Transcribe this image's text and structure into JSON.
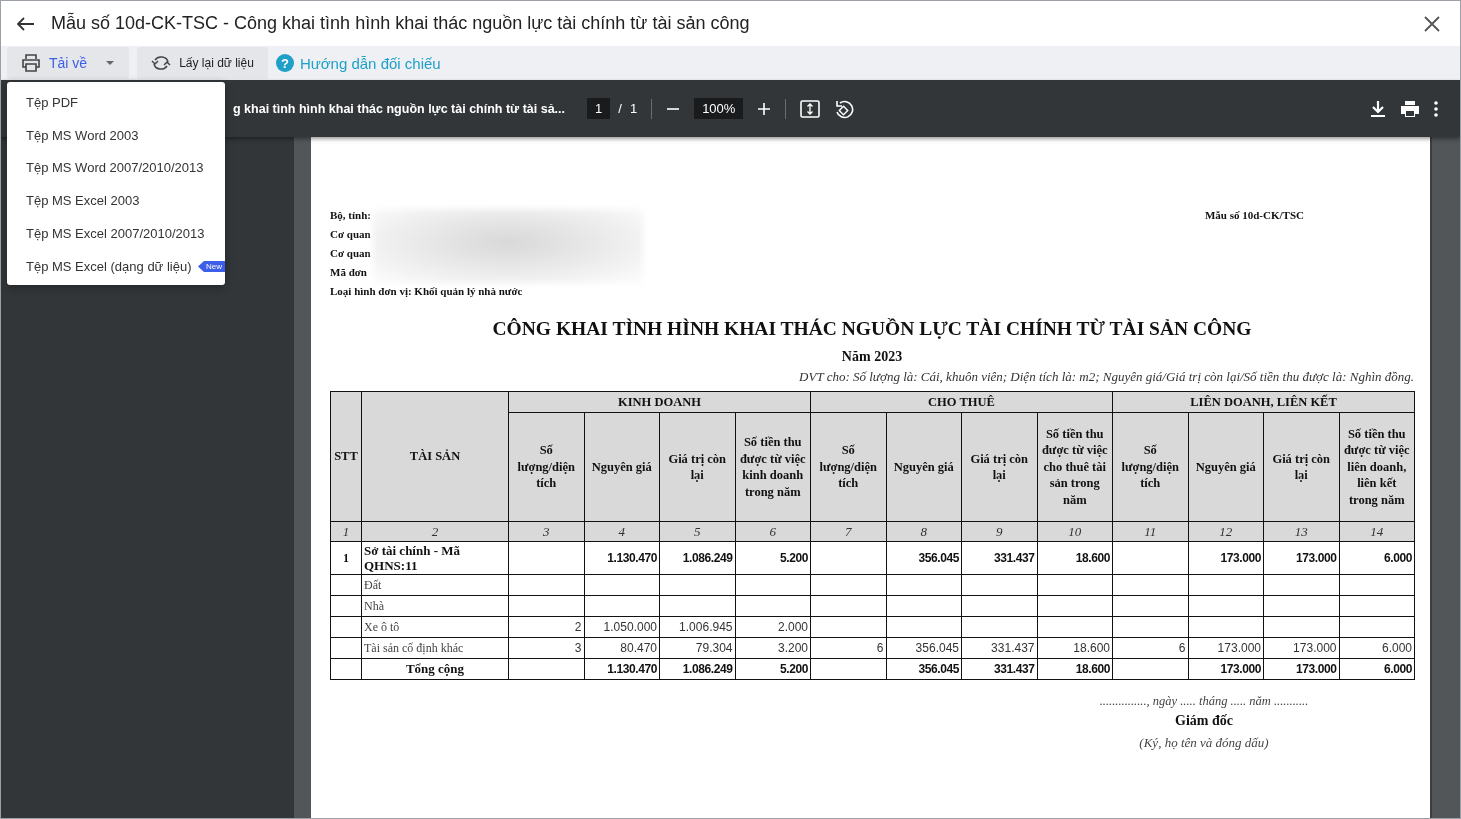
{
  "window": {
    "title": "Mẫu số 10d-CK-TSC - Công khai tình hình khai thác nguồn lực tài chính từ tài sản công"
  },
  "toolbar": {
    "download_button": "Tải về",
    "reload_button": "Lấy lại dữ liệu",
    "help_icon": "?",
    "help_link": "Hướng dẫn đối chiếu"
  },
  "download_menu": {
    "items": [
      {
        "label": "Tệp PDF"
      },
      {
        "label": "Tệp MS Word 2003"
      },
      {
        "label": "Tệp MS Word 2007/2010/2013"
      },
      {
        "label": "Tệp MS Excel 2003"
      },
      {
        "label": "Tệp MS Excel 2007/2010/2013"
      },
      {
        "label": "Tệp MS Excel (dạng dữ liệu)",
        "badge": "New"
      }
    ]
  },
  "viewer": {
    "title": "g khai tình hình khai thác nguồn lực tài chính từ tài sả...",
    "page": "1",
    "separator": "/",
    "pages": "1",
    "zoom": "100%"
  },
  "document": {
    "header_lines": [
      "Bộ, tỉnh:",
      "Cơ quan",
      "Cơ quan",
      "Mã đơn"
    ],
    "unit_type": "Loại hình đơn vị: Khối quản lý nhà nước",
    "form_code": "Mẫu số 10d-CK/TSC",
    "title": "CÔNG KHAI TÌNH HÌNH KHAI THÁC NGUỒN LỰC TÀI CHÍNH TỪ TÀI SẢN CÔNG",
    "year": "Năm 2023",
    "unit_note": "DVT cho: Số lượng là: Cái, khuôn viên; Diện tích là: m2; Nguyên giá/Giá trị còn lại/Số tiền thu được là: Nghìn đồng.",
    "table": {
      "fixed_columns": [
        {
          "label": "STT",
          "number": "1"
        },
        {
          "label": "TÀI SẢN",
          "number": "2"
        }
      ],
      "groups": [
        {
          "label": "KINH DOANH",
          "columns": [
            {
              "label": "Số lượng/diện tích",
              "number": "3"
            },
            {
              "label": "Nguyên giá",
              "number": "4"
            },
            {
              "label": "Giá trị còn lại",
              "number": "5"
            },
            {
              "label": "Số tiền thu được từ việc kinh doanh trong năm",
              "number": "6"
            }
          ]
        },
        {
          "label": "CHO THUÊ",
          "columns": [
            {
              "label": "Số lượng/diện tích",
              "number": "7"
            },
            {
              "label": "Nguyên giá",
              "number": "8"
            },
            {
              "label": "Giá trị còn lại",
              "number": "9"
            },
            {
              "label": "Số tiền thu được từ việc cho thuê tài sản trong năm",
              "number": "10"
            }
          ]
        },
        {
          "label": "LIÊN DOANH, LIÊN KẾT",
          "columns": [
            {
              "label": "Số lượng/diện tích",
              "number": "11"
            },
            {
              "label": "Nguyên giá",
              "number": "12"
            },
            {
              "label": "Giá trị còn lại",
              "number": "13"
            },
            {
              "label": "Số tiền thu được từ việc liên doanh, liên kết trong năm",
              "number": "14"
            }
          ]
        }
      ],
      "rows": [
        {
          "kind": "group",
          "stt": "1",
          "name": "Sở tài chính - Mã QHNS:11",
          "values": {
            "col_4": "1.130.470",
            "col_5": "1.086.249",
            "col_6": "5.200",
            "col_8": "356.045",
            "col_9": "331.437",
            "col_10": "18.600",
            "col_12": "173.000",
            "col_13": "173.000",
            "col_14": "6.000"
          }
        },
        {
          "kind": "item",
          "name": "Đất",
          "values": {}
        },
        {
          "kind": "item",
          "name": "Nhà",
          "values": {}
        },
        {
          "kind": "item",
          "name": "Xe ô tô",
          "values": {
            "col_3": "2",
            "col_4": "1.050.000",
            "col_5": "1.006.945",
            "col_6": "2.000"
          }
        },
        {
          "kind": "item",
          "name": "Tài sản cố định khác",
          "values": {
            "col_3": "3",
            "col_4": "80.470",
            "col_5": "79.304",
            "col_6": "3.200",
            "col_7": "6",
            "col_8": "356.045",
            "col_9": "331.437",
            "col_10": "18.600",
            "col_11": "6",
            "col_12": "173.000",
            "col_13": "173.000",
            "col_14": "6.000"
          }
        },
        {
          "kind": "total",
          "name": "Tổng cộng",
          "values": {
            "col_4": "1.130.470",
            "col_5": "1.086.249",
            "col_6": "5.200",
            "col_8": "356.045",
            "col_9": "331.437",
            "col_10": "18.600",
            "col_12": "173.000",
            "col_13": "173.000",
            "col_14": "6.000"
          }
        }
      ]
    },
    "signature": {
      "date_line": "..............., ngày ..... tháng ..... năm ...........",
      "role": "Giám đốc",
      "note": "(Ký, họ tên và đóng dấu)"
    }
  }
}
